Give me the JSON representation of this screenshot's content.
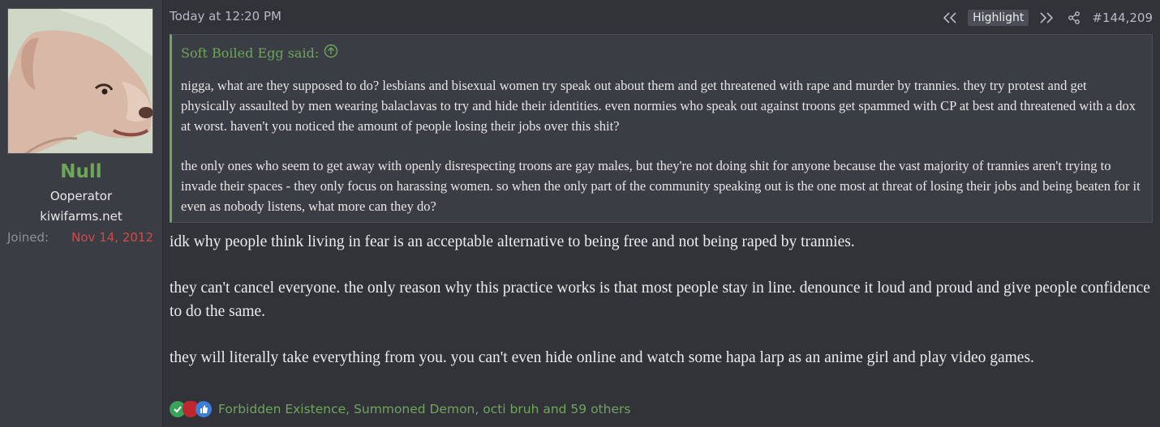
{
  "user": {
    "name": "Null",
    "title": "Ooperator",
    "banner": "kiwifarms.net",
    "joined_label": "Joined:",
    "joined_value": "Nov 14, 2012",
    "name_color": "#6ea65a"
  },
  "post": {
    "time": "Today at 12:20 PM",
    "highlight_label": "Highlight",
    "number": "#144,209",
    "icons": [
      "rewind-icon",
      "fast-forward-icon",
      "share-icon"
    ]
  },
  "quote": {
    "author_label": "Soft Boiled Egg said:",
    "paragraphs": [
      "nigga, what are they supposed to do? lesbians and bisexual women try speak out about them and get threatened with rape and murder by trannies. they try protest and get physically assaulted by men wearing balaclavas to try and hide their identities. even normies who speak out against troons get spammed with CP at best and threatened with a dox at worst. haven't you noticed the amount of people losing their jobs over this shit?",
      "the only ones who seem to get away with openly disrespecting troons are gay males, but they're not doing shit for anyone because the vast majority of trannies aren't trying to invade their spaces - they only focus on harassing women. so when the only part of the community speaking out is the one most at threat of losing their jobs and being beaten for it even as nobody listens, what more can they do?"
    ]
  },
  "message": {
    "paragraphs": [
      "idk why people think living in fear is an acceptable alternative to being free and not being raped by trannies.",
      "they can't cancel everyone. the only reason why this practice works is that most people stay in line. denounce it loud and proud and give people confidence to do the same.",
      "they will literally take everything from you. you can't even hide online and watch some hapa larp as an anime girl and play video games."
    ]
  },
  "reactions": {
    "text": "Forbidden Existence, Summoned Demon, octi bruh and 59 others",
    "icons": [
      "checkmark-icon",
      "demon-icon",
      "thumbs-up-icon"
    ],
    "colors": [
      "#3aa35a",
      "#c0262e",
      "#3b7fd9"
    ]
  }
}
